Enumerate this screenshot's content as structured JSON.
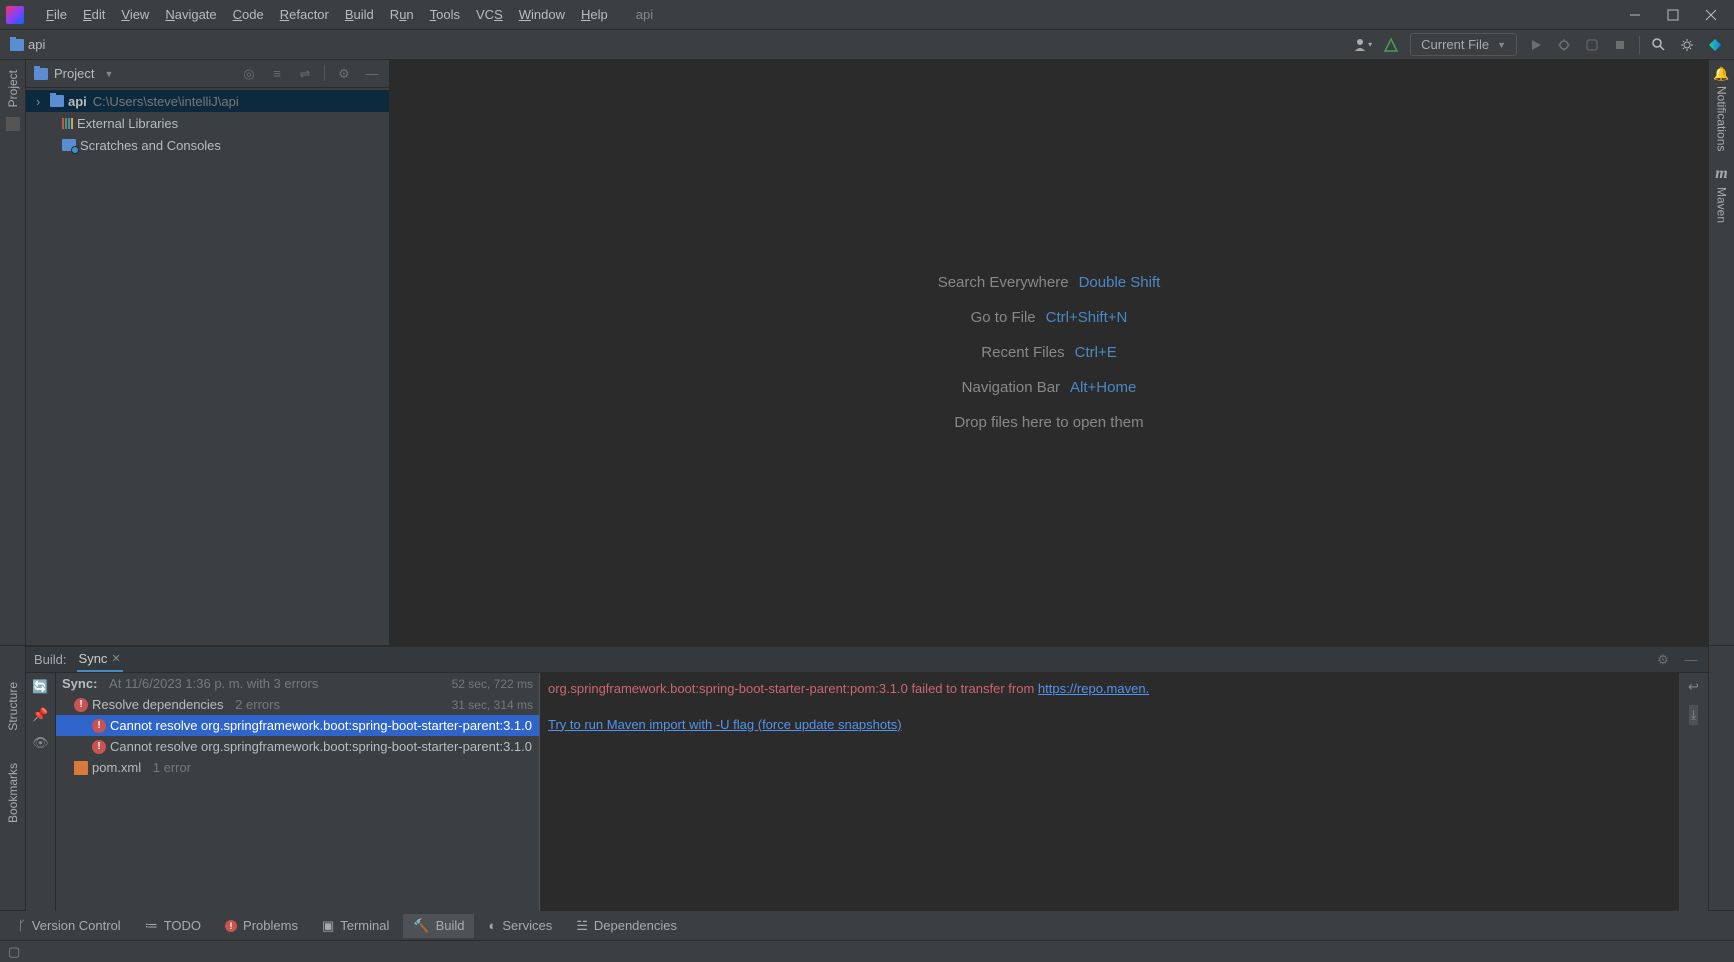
{
  "menu": {
    "file": "File",
    "edit": "Edit",
    "view": "View",
    "navigate": "Navigate",
    "code": "Code",
    "refactor": "Refactor",
    "build": "Build",
    "run": "Run",
    "tools": "Tools",
    "vcs": "VCS",
    "window": "Window",
    "help": "Help"
  },
  "title_project": "api",
  "breadcrumb": "api",
  "run_config": "Current File",
  "project_panel": {
    "title": "Project",
    "root": "api",
    "root_path": "C:\\Users\\steve\\intelliJ\\api",
    "external_libs": "External Libraries",
    "scratches": "Scratches and Consoles"
  },
  "hints": {
    "search": "Search Everywhere",
    "search_key": "Double Shift",
    "goto": "Go to File",
    "goto_key": "Ctrl+Shift+N",
    "recent": "Recent Files",
    "recent_key": "Ctrl+E",
    "navbar": "Navigation Bar",
    "navbar_key": "Alt+Home",
    "drop": "Drop files here to open them"
  },
  "build": {
    "label": "Build:",
    "tab_sync": "Sync",
    "sync_label": "Sync:",
    "sync_time": "At 11/6/2023 1:36 p. m. with 3 errors",
    "sync_duration": "52 sec, 722 ms",
    "resolve": "Resolve dependencies",
    "resolve_errors": "2 errors",
    "resolve_duration": "31 sec, 314 ms",
    "err1": "Cannot resolve org.springframework.boot:spring-boot-starter-parent:3.1.0",
    "err2": "Cannot resolve org.springframework.boot:spring-boot-starter-parent:3.1.0",
    "pom": "pom.xml",
    "pom_errors": "1 error",
    "out_err_prefix": "org.springframework.boot:spring-boot-starter-parent:pom:3.1.0 failed to transfer from ",
    "out_err_link": "https://repo.maven.",
    "out_hint": "Try to run Maven import with -U flag (force update snapshots)"
  },
  "bottom_tabs": {
    "vcs": "Version Control",
    "todo": "TODO",
    "problems": "Problems",
    "terminal": "Terminal",
    "build": "Build",
    "services": "Services",
    "deps": "Dependencies"
  },
  "right_tabs": {
    "notifications": "Notifications",
    "maven": "Maven"
  },
  "left_tabs": {
    "project": "Project",
    "structure": "Structure",
    "bookmarks": "Bookmarks"
  }
}
